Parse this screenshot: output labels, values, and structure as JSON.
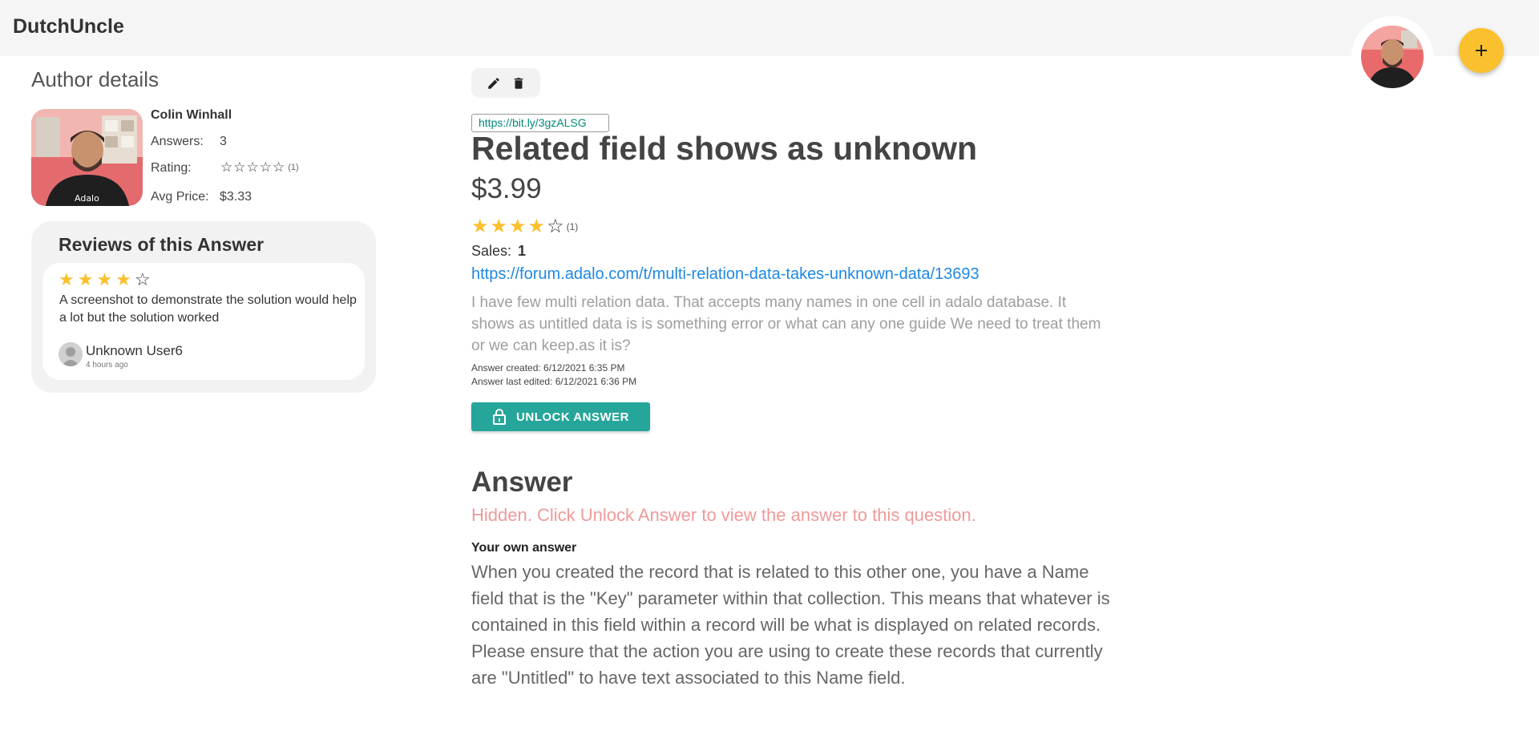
{
  "app": {
    "name": "DutchUncle",
    "accent_color": "#fbc02d",
    "teal_color": "#26a69a",
    "link_color": "#1e88e5",
    "fab_icon": "plus-icon"
  },
  "author": {
    "section_title": "Author details",
    "name": "Colin Winhall",
    "answers_label": "Answers:",
    "answers_value": "3",
    "rating_label": "Rating:",
    "rating_value": 0,
    "rating_count": "(1)",
    "avg_price_label": "Avg Price:",
    "avg_price_value": "$3.33"
  },
  "reviews": {
    "title": "Reviews of this Answer",
    "items": [
      {
        "rating": 4,
        "text": "A screenshot to demonstrate the solution would help a lot but the solution worked",
        "reviewer": "Unknown User6",
        "time": "4 hours ago"
      }
    ]
  },
  "question": {
    "short_link": "https://bit.ly/3gzALSG",
    "title": "Related field shows as unknown",
    "price": "$3.99",
    "rating": 4,
    "rating_count": "(1)",
    "sales_label": "Sales:",
    "sales_value": "1",
    "forum_link": "https://forum.adalo.com/t/multi-relation-data-takes-unknown-data/13693",
    "body": "I have few multi relation data. That accepts many names in one cell in adalo database. It shows as untitled data is is something error or what can any one guide We need to treat them or we can keep.as it is?",
    "created": "Answer created: 6/12/2021 6:35 PM",
    "edited": "Answer last edited: 6/12/2021 6:36 PM",
    "unlock_label": "UNLOCK ANSWER"
  },
  "answer": {
    "heading": "Answer",
    "hidden_note": "Hidden. Click Unlock Answer to view the answer to this question.",
    "own_label": "Your own answer",
    "own_text": "When you created the record that is related to this other one, you have a Name field that is the \"Key\" parameter within that collection. This means that whatever is contained in this field within a record will be what is displayed on related records.   Please ensure that the action you are using to create these records that currently are \"Untitled\" to have text associated to this Name field."
  }
}
